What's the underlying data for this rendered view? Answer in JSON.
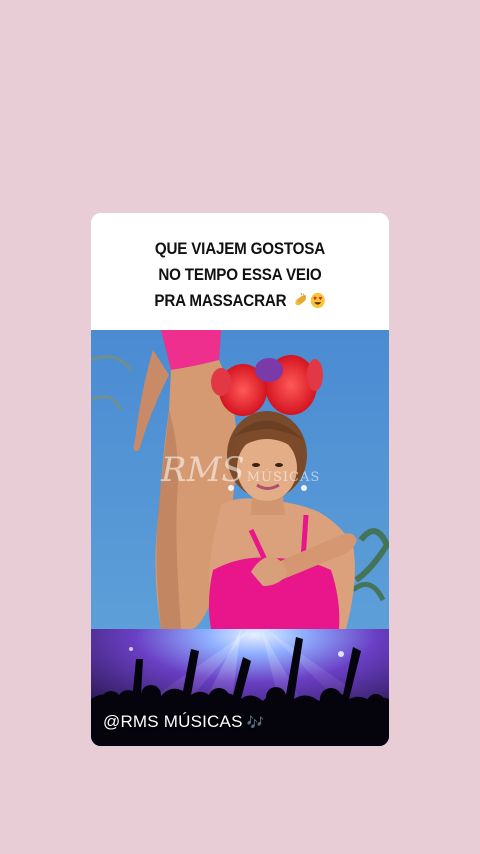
{
  "caption": {
    "line1": "QUE VIAJEM GOSTOSA",
    "line2": "NO TEMPO ESSA VEIO",
    "line3": "PRA MASSACRAR",
    "emojis": [
      "clapping-hands-icon",
      "heart-eyes-icon"
    ]
  },
  "video": {
    "watermark_big": "RMS",
    "watermark_small": "MÚSICAS"
  },
  "footer": {
    "handle": "@RMS MÚSICAS",
    "notes": "🎶"
  },
  "colors": {
    "background": "#e8cdd6",
    "card": "#ffffff",
    "video_sky": "#4f8fd0",
    "bikini": "#e8168a",
    "bow": "#e8222f",
    "concert_purple": "#5a3ea8"
  }
}
